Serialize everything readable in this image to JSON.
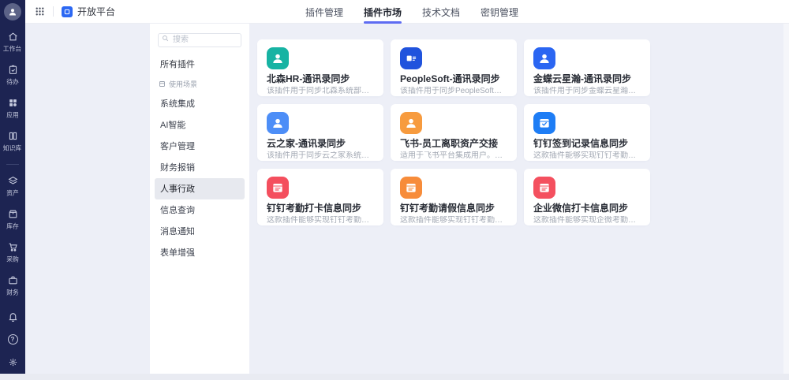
{
  "app": {
    "title": "开放平台"
  },
  "topbar": {
    "tabs": [
      {
        "label": "插件管理",
        "active": false
      },
      {
        "label": "插件市场",
        "active": true
      },
      {
        "label": "技术文档",
        "active": false
      },
      {
        "label": "密钥管理",
        "active": false
      }
    ]
  },
  "rail": {
    "items": [
      {
        "label": "工作台"
      },
      {
        "label": "待办"
      },
      {
        "label": "应用"
      },
      {
        "label": "知识库"
      },
      {
        "label": "资产"
      },
      {
        "label": "库存"
      },
      {
        "label": "采购"
      },
      {
        "label": "财务"
      }
    ],
    "help_glyph": "?"
  },
  "panel": {
    "search_placeholder": "搜索",
    "all_label": "所有插件",
    "section_label": "使用场景",
    "items": [
      {
        "label": "系统集成",
        "selected": false
      },
      {
        "label": "AI智能",
        "selected": false
      },
      {
        "label": "客户管理",
        "selected": false
      },
      {
        "label": "财务报销",
        "selected": false
      },
      {
        "label": "人事行政",
        "selected": true
      },
      {
        "label": "信息查询",
        "selected": false
      },
      {
        "label": "消息通知",
        "selected": false
      },
      {
        "label": "表单增强",
        "selected": false
      }
    ]
  },
  "cards": [
    {
      "title": "北森HR-通讯录同步",
      "desc": "该插件用于同步北森系统部门信息、人员信息",
      "icon_color": "#17b3a3",
      "icon": "person"
    },
    {
      "title": "PeopleSoft-通讯录同步",
      "desc": "该插件用于同步PeopleSoft通讯录信息、部门",
      "icon_color": "#2053dd",
      "icon": "logo"
    },
    {
      "title": "金蝶云星瀚-通讯录同步",
      "desc": "该插件用于同步金蝶云星瀚部门信息、人员",
      "icon_color": "#2b66f2",
      "icon": "person"
    },
    {
      "title": "云之家-通讯录同步",
      "desc": "该插件用于同步云之家系统部门信息、人员",
      "icon_color": "#4d8ef7",
      "icon": "person"
    },
    {
      "title": "飞书-员工离职资产交接",
      "desc": "适用于飞书平台集成用户。当有员工在飞书",
      "icon_color": "#f79b3e",
      "icon": "person"
    },
    {
      "title": "钉钉签到记录信息同步",
      "desc": "这款插件能够实现钉钉考勤系统中签到数据",
      "icon_color": "#1e7df5",
      "icon": "calendar-check"
    },
    {
      "title": "钉钉考勤打卡信息同步",
      "desc": "这款插件能够实现钉钉考勤系统中的打卡数据",
      "icon_color": "#f44f5e",
      "icon": "calendar"
    },
    {
      "title": "钉钉考勤请假信息同步",
      "desc": "这款插件能够实现钉钉考勤系统中的请假数据",
      "icon_color": "#f78c3a",
      "icon": "calendar"
    },
    {
      "title": "企业微信打卡信息同步",
      "desc": "这款插件能够实现企微考勤系统中的打卡数据",
      "icon_color": "#f4505f",
      "icon": "calendar"
    }
  ],
  "colors": {
    "accent": "#5e6cf2",
    "rail_bg": "#1d2452",
    "content_bg": "#edeff7",
    "logo_blue": "#2c68f3"
  }
}
